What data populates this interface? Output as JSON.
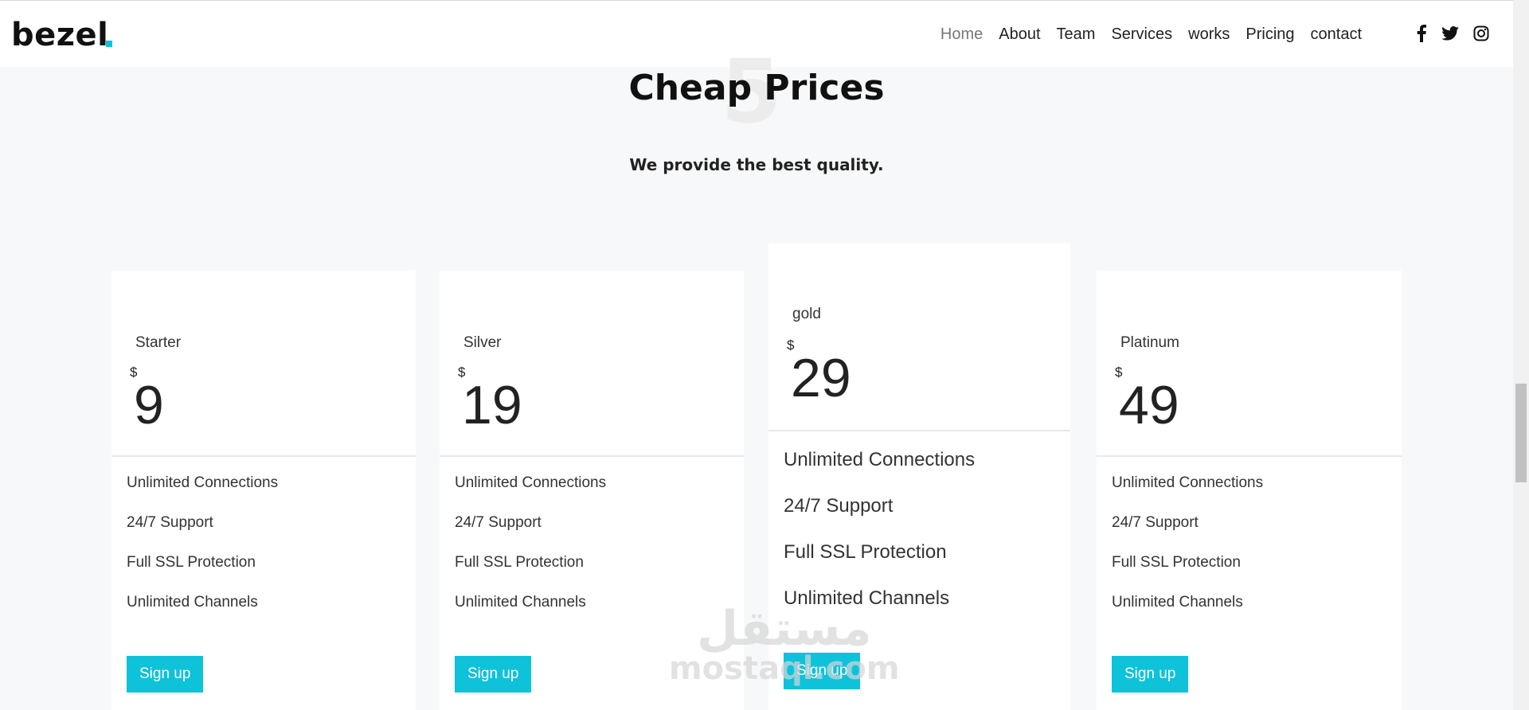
{
  "brand": {
    "logo": "bezel",
    "accent": "#0ec2da"
  },
  "nav": {
    "links": [
      "Home",
      "About",
      "Team",
      "Services",
      "works",
      "Pricing",
      "contact"
    ],
    "active": "Home"
  },
  "socials": [
    "facebook-icon",
    "twitter-icon",
    "instagram-icon"
  ],
  "section": {
    "title": "Cheap Prices",
    "subtitle": "We provide the best quality."
  },
  "plans": [
    {
      "name": "Starter",
      "currency": "$",
      "price": "9",
      "features": [
        "Unlimited Connections",
        "24/7 Support",
        "Full SSL Protection",
        "Unlimited Channels"
      ],
      "cta": "Sign up"
    },
    {
      "name": "Silver",
      "currency": "$",
      "price": "19",
      "features": [
        "Unlimited Connections",
        "24/7 Support",
        "Full SSL Protection",
        "Unlimited Channels"
      ],
      "cta": "Sign up"
    },
    {
      "name": "gold",
      "currency": "$",
      "price": "29",
      "features": [
        "Unlimited Connections",
        "24/7 Support",
        "Full SSL Protection",
        "Unlimited Channels"
      ],
      "cta": "Sign up"
    },
    {
      "name": "Platinum",
      "currency": "$",
      "price": "49",
      "features": [
        "Unlimited Connections",
        "24/7 Support",
        "Full SSL Protection",
        "Unlimited Channels"
      ],
      "cta": "Sign up"
    }
  ],
  "watermark": {
    "arabic": "مستقل",
    "latin": "mostaql.com"
  }
}
